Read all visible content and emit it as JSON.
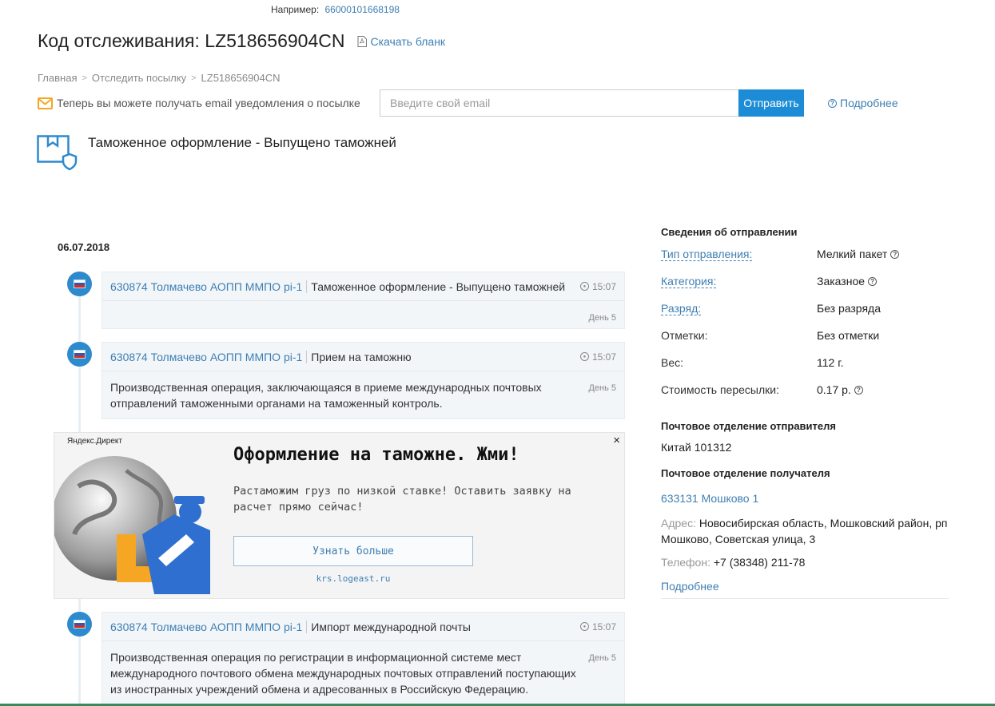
{
  "example": {
    "label": "Например:",
    "code": "66000101668198"
  },
  "header": {
    "title": "Код отслеживания: LZ518656904CN",
    "download_label": "Скачать бланк"
  },
  "breadcrumb": [
    "Главная",
    "Отследить посылку",
    "LZ518656904CN"
  ],
  "notify": {
    "text": "Теперь вы можете получать email уведомления о посылке",
    "email_placeholder": "Введите свой email",
    "send_label": "Отправить",
    "more_label": "Подробнее"
  },
  "status": {
    "text": "Таможенное оформление - Выпущено таможней"
  },
  "timeline": {
    "date": "06.07.2018",
    "events": [
      {
        "office": "630874 Толмачево АОПП ММПО pi-1",
        "operation": "Таможенное оформление - Выпущено таможней",
        "time": "15:07",
        "day": "День 5",
        "description": ""
      },
      {
        "office": "630874 Толмачево АОПП ММПО pi-1",
        "operation": "Прием на таможню",
        "time": "15:07",
        "day": "День 5",
        "description": "Производственная операция, заключающаяся в приеме международных почтовых отправлений таможенными органами на таможенный контроль."
      },
      {
        "office": "630874 Толмачево АОПП ММПО pi-1",
        "operation": "Импорт международной почты",
        "time": "15:07",
        "day": "День 5",
        "description": "Производственная операция по регистрации в информационной системе мест международного почтового обмена международных почтовых отправлений поступающих из иностранных учреждений обмена и адресованных в Российскую Федерацию."
      }
    ]
  },
  "ad": {
    "label": "Яндекс.Директ",
    "close": "×",
    "title": "Оформление на таможне. Жми!",
    "text": "Растаможим груз по низкой ставке! Оставить заявку на расчет прямо сейчас!",
    "button": "Узнать больше",
    "url": "krs.logeast.ru"
  },
  "info": {
    "title": "Сведения об отправлении",
    "rows": [
      {
        "key": "Тип отправления:",
        "value": "Мелкий пакет"
      },
      {
        "key": "Категория:",
        "value": "Заказное"
      },
      {
        "key": "Разряд:",
        "value": "Без разряда"
      },
      {
        "key": "Отметки:",
        "value": "Без отметки"
      },
      {
        "key": "Вес:",
        "value": "112 г."
      },
      {
        "key": "Стоимость пересылки:",
        "value": "0.17 р."
      }
    ],
    "sender_title": "Почтовое отделение отправителя",
    "sender_office": "Китай 101312",
    "recipient_title": "Почтовое отделение получателя",
    "recipient_office": "633131 Мошково 1",
    "address_label": "Адрес:",
    "address": "Новосибирская область, Мошковский район, рп Мошково, Советская улица, 3",
    "phone_label": "Телефон:",
    "phone": "+7 (38348) 211-78",
    "more_label": "Подробнее"
  },
  "colors": {
    "accent": "#1d8cd6",
    "link": "#3d7fb3",
    "notify_icon": "#f5a623"
  }
}
